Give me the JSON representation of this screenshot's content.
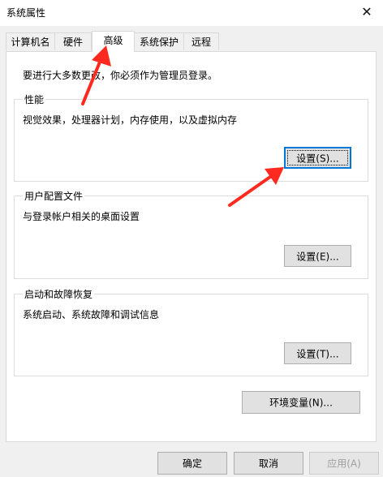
{
  "window": {
    "title": "系统属性",
    "close_glyph": "✕"
  },
  "tabs": [
    {
      "label": "计算机名"
    },
    {
      "label": "硬件"
    },
    {
      "label": "高级"
    },
    {
      "label": "系统保护"
    },
    {
      "label": "远程"
    }
  ],
  "panel": {
    "admin_notice": "要进行大多数更改，你必须作为管理员登录。",
    "performance": {
      "title": "性能",
      "description": "视觉效果，处理器计划，内存使用，以及虚拟内存",
      "button": "设置(S)..."
    },
    "user_profiles": {
      "title": "用户配置文件",
      "description": "与登录帐户相关的桌面设置",
      "button": "设置(E)..."
    },
    "startup_recovery": {
      "title": "启动和故障恢复",
      "description": "系统启动、系统故障和调试信息",
      "button": "设置(T)..."
    },
    "env_button": "环境变量(N)..."
  },
  "footer": {
    "ok": "确定",
    "cancel": "取消",
    "apply": "应用(A)"
  },
  "colors": {
    "annotation_arrow": "#ff2a1f",
    "focus_border": "#0078d7"
  }
}
